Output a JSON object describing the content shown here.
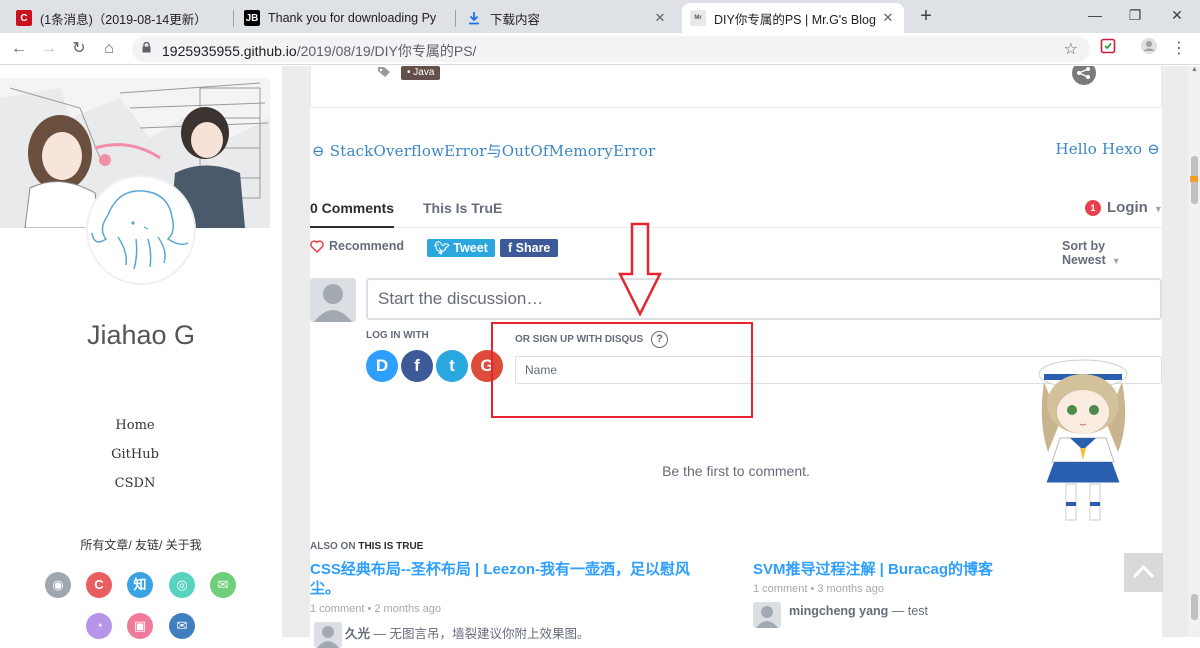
{
  "browser": {
    "tabs": [
      {
        "title": "(1条消息)（2019-08-14更新）",
        "favicon": "csdn-icon"
      },
      {
        "title": "Thank you for downloading Py",
        "favicon": "jetbrains-icon"
      },
      {
        "title": "下载内容",
        "favicon": "download-icon"
      },
      {
        "title": "DIY你专属的PS | Mr.G's Blog",
        "favicon": "blog-icon"
      }
    ],
    "new_tab": "+",
    "url_host": "1925935955.github.io",
    "url_path": "/2019/08/19/DIY你专属的PS/"
  },
  "sidebar": {
    "author": "Jiahao G",
    "menu": [
      "Home",
      "GitHub",
      "CSDN"
    ],
    "sublinks": "所有文章/ 友链/ 关于我",
    "social_icons": [
      "github-icon",
      "csdn-icon",
      "zhihu-icon",
      "qq-icon",
      "wechat-icon",
      "weibo-icon",
      "bilibili-icon",
      "email-icon"
    ]
  },
  "article": {
    "tag": "• Java"
  },
  "post_nav": {
    "prev": "⊖ StackOverflowError与OutOfMemoryError",
    "next": "Hello Hexo ⊖"
  },
  "disqus": {
    "comments_tab": "0 Comments",
    "site_tab": "This Is TruE",
    "login_badge": "1",
    "login": "Login",
    "recommend": "Recommend",
    "tweet": "Tweet",
    "share": "Share",
    "sort": "Sort by Newest",
    "discussion_placeholder": "Start the discussion…",
    "log_in_with": "LOG IN WITH",
    "login_providers": [
      "D",
      "f",
      "t",
      "G"
    ],
    "signup_label": "OR SIGN UP WITH DISQUS",
    "help": "?",
    "name_placeholder": "Name",
    "first_comment": "Be the first to comment.",
    "also_on_prefix": "ALSO ON",
    "also_on_site": "THIS IS TRUE",
    "recommendations": [
      {
        "title": "CSS经典布局--圣杯布局 | Leezon-我有一壶酒，足以慰风尘。",
        "meta": "1 comment • 2 months ago",
        "user": "久光",
        "excerpt": "— 无图言吊，墙裂建议你附上效果图。"
      },
      {
        "title": "SVM推导过程注解 | Buracag的博客",
        "meta": "1 comment • 3 months ago",
        "user": "mingcheng yang",
        "excerpt": "— test"
      }
    ]
  },
  "colors": {
    "link": "#3b87c6",
    "disqus_blue": "#2e9fff",
    "annotation_red": "#e8232d",
    "tweet": "#2ba7df",
    "facebook": "#3d5a98"
  }
}
